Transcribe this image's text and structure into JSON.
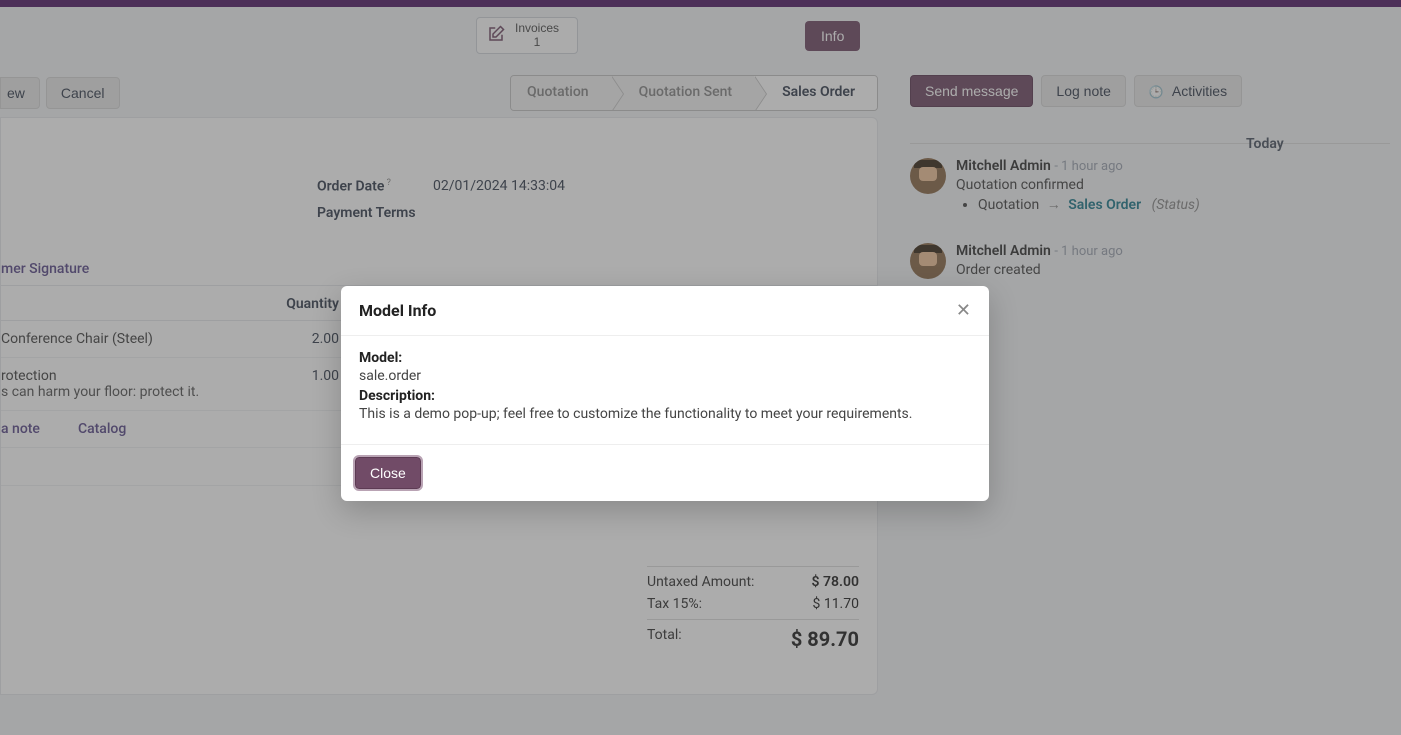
{
  "header": {
    "invoices_label": "Invoices",
    "invoices_count": "1",
    "info_button": "Info"
  },
  "action_buttons": {
    "partial_left": "ew",
    "cancel": "Cancel"
  },
  "status_steps": {
    "quotation": "Quotation",
    "quotation_sent": "Quotation Sent",
    "sales_order": "Sales Order"
  },
  "form": {
    "order_date_label": "Order Date",
    "order_date_value": "02/01/2024 14:33:04",
    "payment_terms_label": "Payment Terms",
    "tab_signature_partial": "mer Signature"
  },
  "table": {
    "header_quantity": "Quantity",
    "rows": [
      {
        "name": "Conference Chair (Steel)",
        "sub": "",
        "qty": "2.00"
      },
      {
        "name": "rotection",
        "sub": "s can harm your floor: protect it.",
        "qty": "1.00"
      }
    ],
    "add_note_partial": "a note",
    "catalog": "Catalog"
  },
  "totals": {
    "untaxed_label": "Untaxed Amount:",
    "untaxed_value": "$ 78.00",
    "tax_label": "Tax 15%:",
    "tax_value": "$ 11.70",
    "total_label": "Total:",
    "total_value": "$ 89.70"
  },
  "chatter": {
    "send_message": "Send message",
    "log_note": "Log note",
    "activities": "Activities",
    "today": "Today",
    "messages": [
      {
        "author": "Mitchell Admin",
        "time": "- 1 hour ago",
        "body": "Quotation confirmed",
        "bullet_from": "Quotation",
        "bullet_to": "Sales Order",
        "bullet_status": "(Status)"
      },
      {
        "author": "Mitchell Admin",
        "time": "- 1 hour ago",
        "body": "Order created"
      }
    ]
  },
  "modal": {
    "title": "Model Info",
    "model_label": "Model:",
    "model_value": "sale.order",
    "desc_label": "Description:",
    "desc_value": "This is a demo pop-up; feel free to customize the functionality to meet your requirements.",
    "close": "Close"
  }
}
